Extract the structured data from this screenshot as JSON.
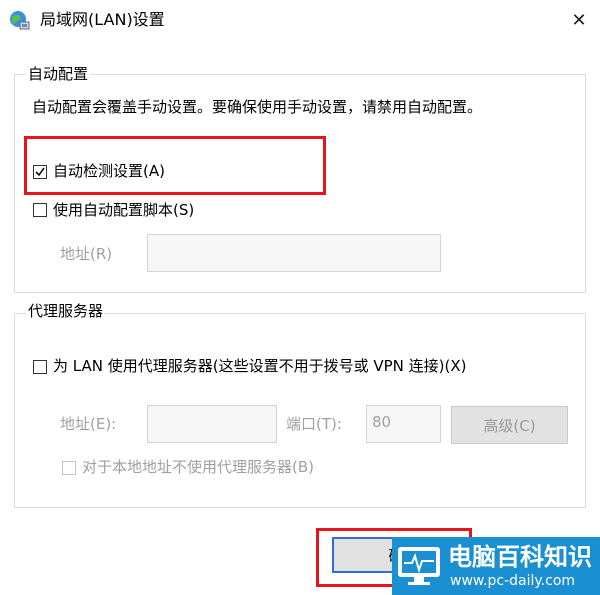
{
  "window": {
    "title": "局域网(LAN)设置",
    "close_glyph": "✕"
  },
  "auto_config": {
    "legend": "自动配置",
    "description": "自动配置会覆盖手动设置。要确保使用手动设置，请禁用自动配置。",
    "auto_detect": {
      "label": "自动检测设置(A)",
      "checked": true
    },
    "use_script": {
      "label": "使用自动配置脚本(S)",
      "checked": false
    },
    "address": {
      "label": "地址(R)",
      "value": ""
    }
  },
  "proxy": {
    "legend": "代理服务器",
    "use_proxy": {
      "label": "为 LAN 使用代理服务器(这些设置不用于拨号或 VPN 连接)(X)",
      "checked": false
    },
    "address_label": "地址(E):",
    "address_value": "",
    "port_label": "端口(T):",
    "port_value": "80",
    "advanced_label": "高级(C)",
    "bypass_local": {
      "label": "对于本地地址不使用代理服务器(B)",
      "checked": false
    }
  },
  "buttons": {
    "ok_label": "确"
  },
  "watermark": {
    "text": "电脑百科知识",
    "url": "www.pc-daily.com"
  },
  "colors": {
    "highlight": "#e8141b",
    "watermark_bg": "#1a8fd1",
    "ok_border": "#2d6fd6"
  }
}
